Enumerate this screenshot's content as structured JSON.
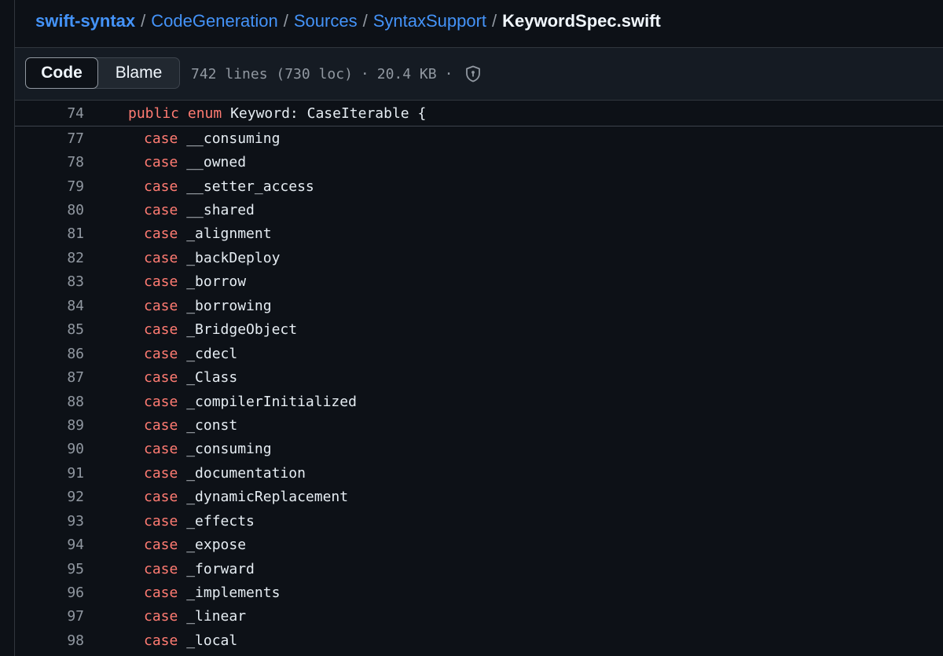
{
  "breadcrumb": {
    "root": "swift-syntax",
    "separator": "/",
    "segments": [
      "CodeGeneration",
      "Sources",
      "SyntaxSupport"
    ],
    "current": "KeywordSpec.swift"
  },
  "toolbar": {
    "tabs": [
      "Code",
      "Blame"
    ],
    "active_tab": "Code",
    "lines_info": "742 lines (730 loc)",
    "dot": "·",
    "size": "20.4 KB",
    "shield_icon": "shield-lock-icon"
  },
  "code": {
    "sticky": {
      "line_number": "74",
      "kw1": "public",
      "kw2": "enum",
      "rest": " Keyword: CaseIterable {"
    },
    "case_keyword": "case",
    "lines": [
      {
        "n": "77",
        "name": "__consuming"
      },
      {
        "n": "78",
        "name": "__owned"
      },
      {
        "n": "79",
        "name": "__setter_access"
      },
      {
        "n": "80",
        "name": "__shared"
      },
      {
        "n": "81",
        "name": "_alignment"
      },
      {
        "n": "82",
        "name": "_backDeploy"
      },
      {
        "n": "83",
        "name": "_borrow"
      },
      {
        "n": "84",
        "name": "_borrowing"
      },
      {
        "n": "85",
        "name": "_BridgeObject"
      },
      {
        "n": "86",
        "name": "_cdecl"
      },
      {
        "n": "87",
        "name": "_Class"
      },
      {
        "n": "88",
        "name": "_compilerInitialized"
      },
      {
        "n": "89",
        "name": "_const"
      },
      {
        "n": "90",
        "name": "_consuming"
      },
      {
        "n": "91",
        "name": "_documentation"
      },
      {
        "n": "92",
        "name": "_dynamicReplacement"
      },
      {
        "n": "93",
        "name": "_effects"
      },
      {
        "n": "94",
        "name": "_expose"
      },
      {
        "n": "95",
        "name": "_forward"
      },
      {
        "n": "96",
        "name": "_implements"
      },
      {
        "n": "97",
        "name": "_linear"
      },
      {
        "n": "98",
        "name": "_local"
      }
    ]
  },
  "colors": {
    "background": "#0d1117",
    "link": "#4493f8",
    "keyword": "#ff7b72",
    "muted": "#9198a1"
  }
}
